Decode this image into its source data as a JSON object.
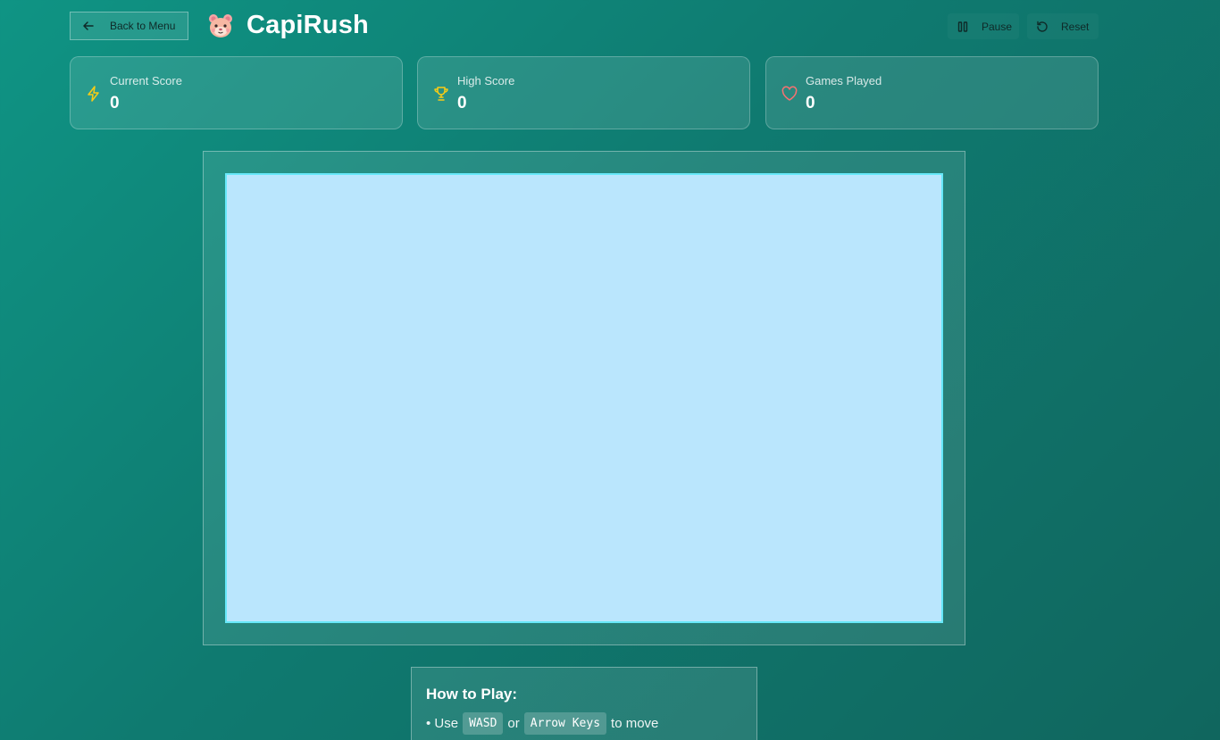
{
  "header": {
    "back_label": "Back to Menu",
    "app_title": "CapiRush",
    "logo_icon": "hamster-face-icon",
    "pause_label": "Pause",
    "reset_label": "Reset"
  },
  "stats": {
    "current": {
      "label": "Current Score",
      "value": "0",
      "icon": "lightning-icon",
      "icon_color": "#facc15"
    },
    "high": {
      "label": "High Score",
      "value": "0",
      "icon": "trophy-icon",
      "icon_color": "#facc15"
    },
    "games": {
      "label": "Games Played",
      "value": "0",
      "icon": "heart-icon",
      "icon_color": "#f87171"
    }
  },
  "board": {
    "background": "#bae6fd",
    "border": "#67e8f9"
  },
  "instructions": {
    "heading": "How to Play:",
    "line1": {
      "prefix": "• Use",
      "key1": "WASD",
      "or": "or",
      "key2": "Arrow Keys",
      "suffix": "to move"
    }
  },
  "colors": {
    "bg_start": "#0f9484",
    "bg_end": "#10665e"
  }
}
